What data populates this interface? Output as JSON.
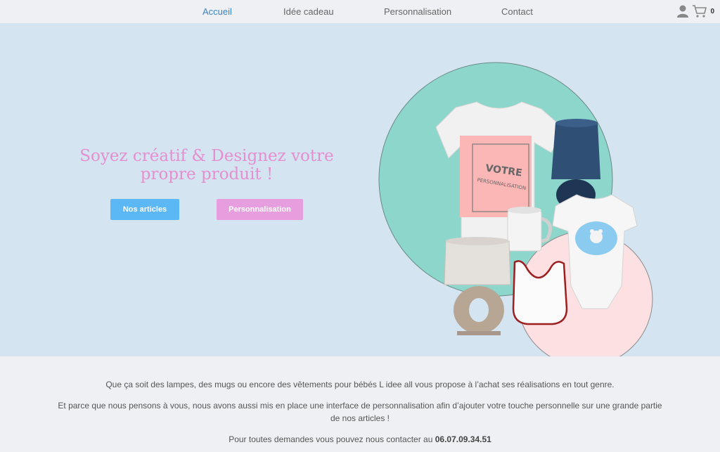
{
  "nav": {
    "items": [
      "Accueil",
      "Idée cadeau",
      "Personnalisation",
      "Contact"
    ],
    "cart_count": "0"
  },
  "hero": {
    "title": "Soyez créatif & Designez votre propre produit !",
    "btn_articles": "Nos articles",
    "btn_perso": "Personnalisation",
    "tshirt_votre": "VOTRE",
    "tshirt_perso": "PERSONNALISATION"
  },
  "intro": {
    "line1": "Que ça soit des lampes, des mugs ou encore des vêtements pour bébés L idee all vous propose à l’achat ses réalisations en tout genre.",
    "line2": "Et parce que nous pensons à vous, nous avons aussi mis en place une interface de personnalisation afin d’ajouter votre touche personnelle sur une grande partie de nos articles !",
    "line3_text": "Pour toutes demandes vous pouvez nous contacter au",
    "phone": "06.07.09.34.51"
  },
  "colors": {
    "accent_blue": "#5cb8f5",
    "accent_pink": "#e79ede",
    "hero_bg": "#d4e4f1",
    "circle_teal": "#8dd6cb",
    "circle_pink": "#fde1e2"
  }
}
